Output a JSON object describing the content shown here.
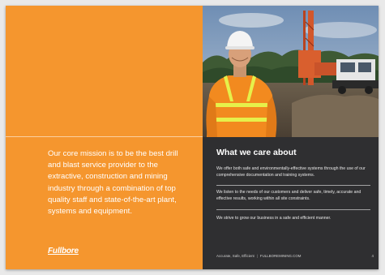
{
  "left_panel": {
    "mission": "Our core mission is to be the best drill and blast service provider to the extractive, construction and mining industry through a combination of top quality staff and state-of-the-art plant, systems and equipment.",
    "logo_text": "Fullbore"
  },
  "right_panel": {
    "title": "What we care about",
    "paragraphs": [
      "We offer both safe and environmentally-effective systems through the use of our comprehensive documentation and training systems.",
      "We listen to the needs of our customers and deliver safe, timely, accurate and effective results, working within all site constraints.",
      "We strive to grow our business in a safe and efficient manner."
    ],
    "footer": {
      "tagline": "Accurate, Safe, Efficient",
      "website": "FULLBOREMINING.COM",
      "page_number": "4"
    }
  },
  "colors": {
    "accent_orange": "#f5962e",
    "dark_panel": "#2f2f31",
    "text_light": "#ffffff"
  },
  "photo": {
    "subject": "worker-in-hi-vis-with-drill-rig"
  }
}
